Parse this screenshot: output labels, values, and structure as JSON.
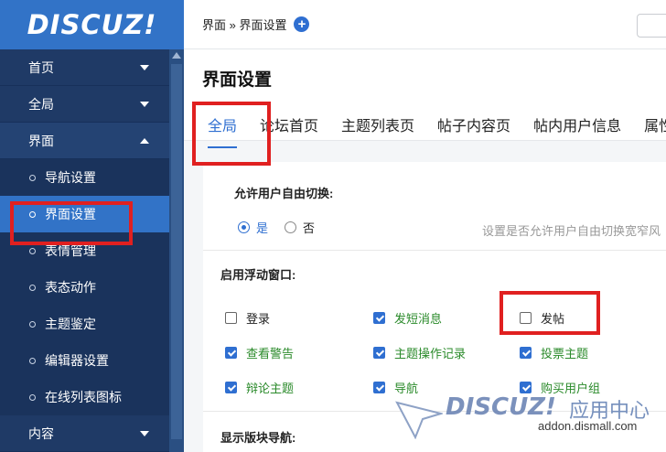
{
  "logo": "DISCUZ!",
  "sidebar": {
    "groups": [
      {
        "label": "首页"
      },
      {
        "label": "全局"
      },
      {
        "label": "界面"
      },
      {
        "label": "内容"
      }
    ],
    "items": [
      {
        "label": "导航设置"
      },
      {
        "label": "界面设置"
      },
      {
        "label": "表情管理"
      },
      {
        "label": "表态动作"
      },
      {
        "label": "主题鉴定"
      },
      {
        "label": "编辑器设置"
      },
      {
        "label": "在线列表图标"
      }
    ]
  },
  "breadcrumb": "界面 » 界面设置",
  "page_title": "界面设置",
  "tabs": [
    {
      "label": "全局"
    },
    {
      "label": "论坛首页"
    },
    {
      "label": "主题列表页"
    },
    {
      "label": "帖子内容页"
    },
    {
      "label": "帖内用户信息"
    },
    {
      "label": "属性"
    }
  ],
  "sections": {
    "switch_title": "允许用户自由切换:",
    "radio_yes": "是",
    "radio_no": "否",
    "switch_hint": "设置是否允许用户自由切换宽窄风",
    "float_title": "启用浮动窗口:",
    "nav_title": "显示版块导航:"
  },
  "checkboxes": [
    {
      "label": "登录",
      "checked": false
    },
    {
      "label": "发短消息",
      "checked": true
    },
    {
      "label": "发帖",
      "checked": false
    },
    {
      "label": "查看警告",
      "checked": true
    },
    {
      "label": "主题操作记录",
      "checked": true
    },
    {
      "label": "投票主题",
      "checked": true
    },
    {
      "label": "辩论主题",
      "checked": true
    },
    {
      "label": "导航",
      "checked": true
    },
    {
      "label": "购买用户组",
      "checked": true
    }
  ],
  "watermark": {
    "logo": "DISCUZ!",
    "cn": "应用中心",
    "url": "addon.dismall.com"
  },
  "colors": {
    "sidebar_bg": "#1f3a66",
    "accent": "#2f6fd1",
    "highlight": "#e02020",
    "checked_label": "#2a8a2a"
  }
}
